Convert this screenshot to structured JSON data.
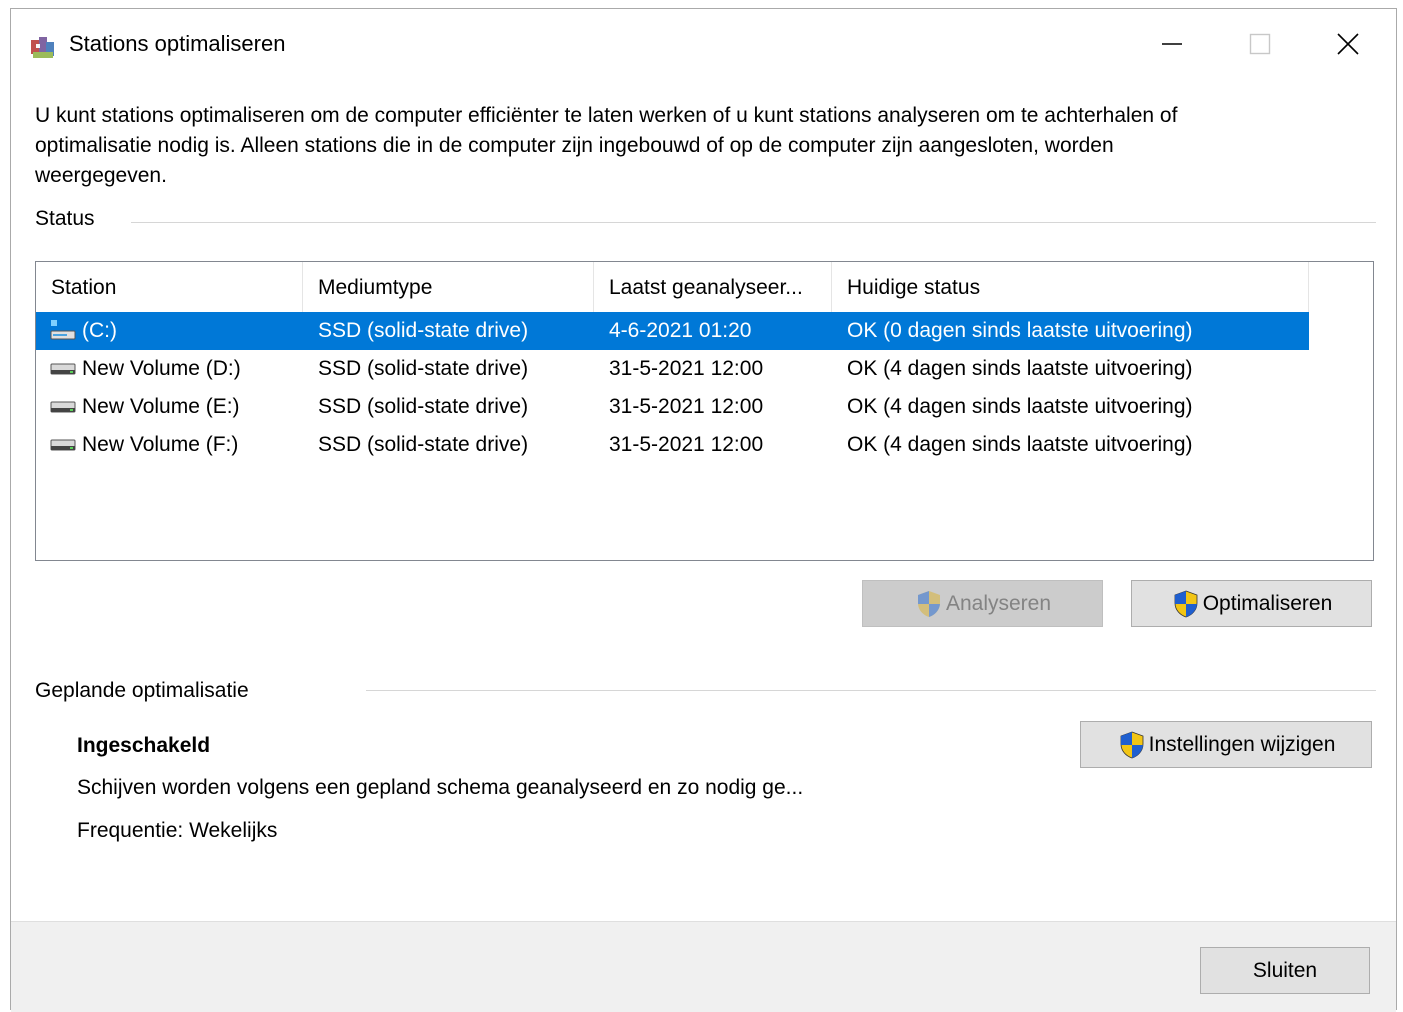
{
  "window": {
    "title": "Stations optimaliseren",
    "controls": {
      "minimize": "—",
      "maximize": "☐",
      "close": "✕"
    }
  },
  "description": "U kunt stations optimaliseren om de computer efficiënter te laten werken of u kunt stations analyseren om te achterhalen of optimalisatie nodig is. Alleen stations die in de computer zijn ingebouwd of op de computer zijn aangesloten, worden weergegeven.",
  "status": {
    "label": "Status",
    "columns": [
      "Station",
      "Mediumtype",
      "Laatst geanalyseer...",
      "Huidige status"
    ],
    "rows": [
      {
        "station": "(C:)",
        "media": "SSD (solid-state drive)",
        "last": "4-6-2021 01:20",
        "status": "OK (0 dagen sinds laatste uitvoering)",
        "icon": "system-drive-icon",
        "selected": true
      },
      {
        "station": "New Volume (D:)",
        "media": "SSD (solid-state drive)",
        "last": "31-5-2021 12:00",
        "status": "OK (4 dagen sinds laatste uitvoering)",
        "icon": "drive-icon",
        "selected": false
      },
      {
        "station": "New Volume (E:)",
        "media": "SSD (solid-state drive)",
        "last": "31-5-2021 12:00",
        "status": "OK (4 dagen sinds laatste uitvoering)",
        "icon": "drive-icon",
        "selected": false
      },
      {
        "station": "New Volume (F:)",
        "media": "SSD (solid-state drive)",
        "last": "31-5-2021 12:00",
        "status": "OK (4 dagen sinds laatste uitvoering)",
        "icon": "drive-icon",
        "selected": false
      }
    ]
  },
  "actions": {
    "analyze": "Analyseren",
    "optimize": "Optimaliseren"
  },
  "scheduled": {
    "label": "Geplande optimalisatie",
    "state": "Ingeschakeld",
    "detail": "Schijven worden volgens een gepland schema geanalyseerd en zo nodig ge...",
    "frequency": "Frequentie: Wekelijks",
    "change_button": "Instellingen wijzigen"
  },
  "footer": {
    "close_button": "Sluiten"
  },
  "colors": {
    "selection": "#0078d7",
    "button_face": "#e1e1e1",
    "footer_bg": "#f0f0f0"
  }
}
